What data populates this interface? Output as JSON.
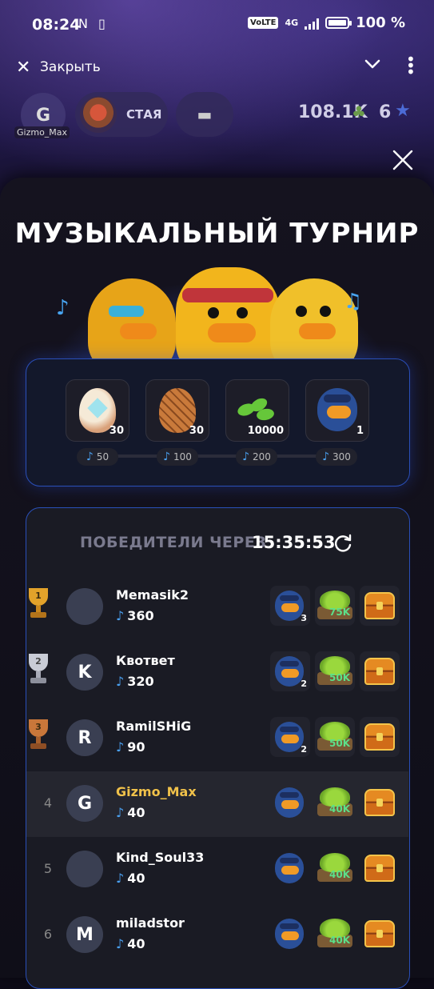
{
  "status_bar": {
    "time": "08:24",
    "left_icons": "N ▯",
    "volte": "VoLTE",
    "network": "4G",
    "battery": "100 %"
  },
  "topbar": {
    "close_label": "Закрыть"
  },
  "header": {
    "avatar_letter": "G",
    "username": "Gizmo_Max",
    "pack_label": "СТАЯ",
    "balance": "108.1K",
    "stars": "6"
  },
  "tournament": {
    "title": "МУЗЫКАЛЬНЫЙ ТУРНИР",
    "tiers": [
      {
        "reward": "egg-diamond",
        "qty": "30",
        "threshold": "50"
      },
      {
        "reward": "egg-cracked",
        "qty": "30",
        "threshold": "100"
      },
      {
        "reward": "seeds",
        "qty": "10000",
        "threshold": "200"
      },
      {
        "reward": "duck-character",
        "qty": "1",
        "threshold": "300"
      }
    ],
    "winners_label": "ПОБЕДИТЕЛИ ЧЕРЕЗ",
    "timer": "15:35:53"
  },
  "leaderboard": [
    {
      "rank": "1",
      "letter": "",
      "name": "Memasik2",
      "score": "360",
      "duck_qty": "3",
      "seeds": "75K",
      "cup": "gold"
    },
    {
      "rank": "2",
      "letter": "K",
      "name": "Кв​ответ",
      "score": "320",
      "duck_qty": "2",
      "seeds": "50K",
      "cup": "silver"
    },
    {
      "rank": "3",
      "letter": "R",
      "name": "RamilSHiG",
      "score": "90",
      "duck_qty": "2",
      "seeds": "50K",
      "cup": "bronze"
    },
    {
      "rank": "4",
      "letter": "G",
      "name": "Gizmo_Max",
      "score": "40",
      "duck_qty": "",
      "seeds": "40K",
      "me": true
    },
    {
      "rank": "5",
      "letter": "",
      "name": "Kind_Soul33",
      "score": "40",
      "duck_qty": "",
      "seeds": "40K"
    },
    {
      "rank": "6",
      "letter": "M",
      "name": "miladstor",
      "score": "40",
      "duck_qty": "",
      "seeds": "40K"
    }
  ],
  "colors": {
    "accent_border": "#2a4fb8",
    "me_name": "#f0c14a",
    "note": "#4aa0f0",
    "seeds_qty": "#5ce08a"
  }
}
